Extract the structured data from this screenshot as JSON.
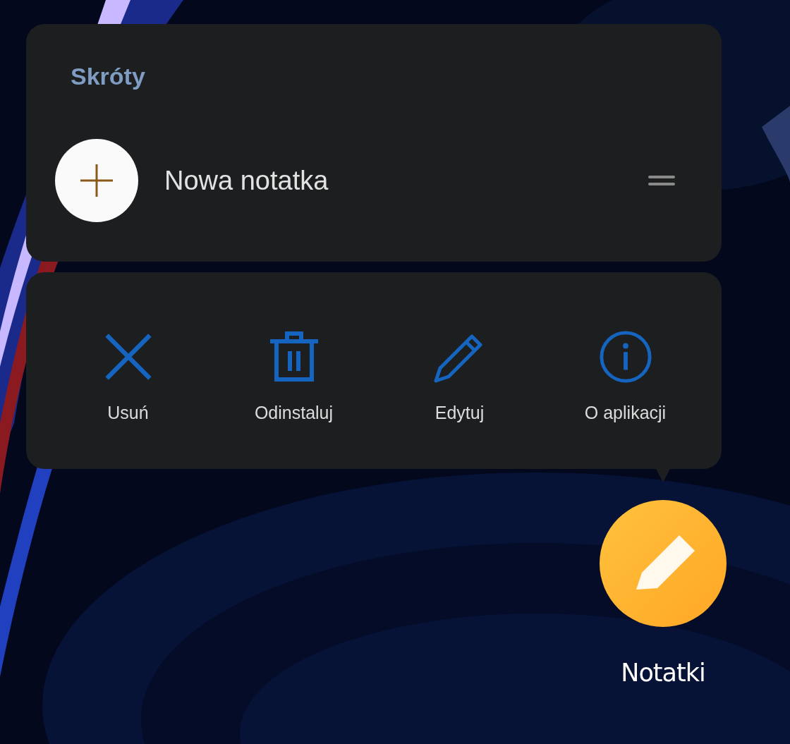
{
  "shortcuts": {
    "title": "Skróty",
    "items": [
      {
        "label": "Nowa notatka"
      }
    ]
  },
  "actions": [
    {
      "kind": "close",
      "label": "Usuń"
    },
    {
      "kind": "trash",
      "label": "Odinstaluj"
    },
    {
      "kind": "edit",
      "label": "Edytuj"
    },
    {
      "kind": "info",
      "label": "O aplikacji"
    }
  ],
  "app": {
    "label": "Notatki"
  }
}
